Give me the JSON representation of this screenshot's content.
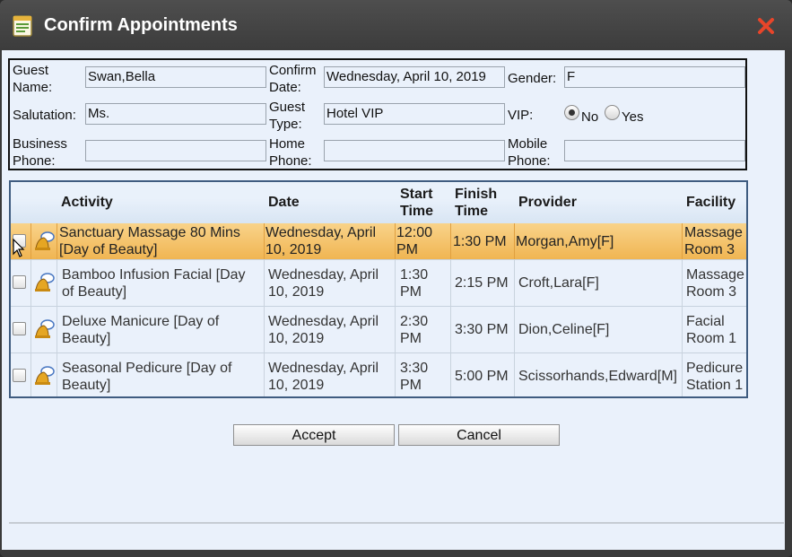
{
  "window": {
    "title": "Confirm Appointments",
    "icon": "document-icon",
    "close_icon": "close-x-icon",
    "accent": "#e8452a"
  },
  "guest": {
    "name_label_1": "Guest",
    "name_label_2": "Name:",
    "name_value": "Swan,Bella",
    "confirm_label_1": "Confirm",
    "confirm_label_2": "Date:",
    "confirm_value": "Wednesday, April 10, 2019",
    "gender_label": "Gender:",
    "gender_value": "F",
    "salutation_label": "Salutation:",
    "salutation_value": "Ms.",
    "type_label_1": "Guest",
    "type_label_2": "Type:",
    "type_value": "Hotel VIP",
    "vip_label": "VIP:",
    "vip_no": "No",
    "vip_yes": "Yes",
    "vip_selected": "No",
    "business_label_1": "Business",
    "business_label_2": "Phone:",
    "business_value": "",
    "home_label_1": "Home",
    "home_label_2": "Phone:",
    "home_value": "",
    "mobile_label_1": "Mobile",
    "mobile_label_2": "Phone:",
    "mobile_value": ""
  },
  "table": {
    "headers": {
      "activity": "Activity",
      "date": "Date",
      "start_1": "Start",
      "start_2": "Time",
      "finish_1": "Finish",
      "finish_2": "Time",
      "provider": "Provider",
      "facility": "Facility"
    },
    "rows": [
      {
        "activity_1": "Sanctuary Massage 80 Mins",
        "activity_2": "[Day of Beauty]",
        "date_1": "Wednesday, April",
        "date_2": "10, 2019",
        "start_1": "12:00",
        "start_2": "PM",
        "finish": "1:30 PM",
        "provider": "Morgan,Amy[F]",
        "facility_1": "Massage",
        "facility_2": "Room 3",
        "selected": true
      },
      {
        "activity_1": "Bamboo Infusion Facial [Day",
        "activity_2": "of Beauty]",
        "date_1": "Wednesday, April",
        "date_2": "10, 2019",
        "start_1": "1:30",
        "start_2": "PM",
        "finish": "2:15 PM",
        "provider": "Croft,Lara[F]",
        "facility_1": "Massage",
        "facility_2": "Room 3",
        "selected": false
      },
      {
        "activity_1": "Deluxe Manicure [Day of",
        "activity_2": "Beauty]",
        "date_1": "Wednesday, April",
        "date_2": "10, 2019",
        "start_1": "2:30",
        "start_2": "PM",
        "finish": "3:30 PM",
        "provider": "Dion,Celine[F]",
        "facility_1": "Facial",
        "facility_2": "Room 1",
        "selected": false
      },
      {
        "activity_1": "Seasonal Pedicure [Day of",
        "activity_2": "Beauty]",
        "date_1": "Wednesday, April",
        "date_2": "10, 2019",
        "start_1": "3:30",
        "start_2": "PM",
        "finish": "5:00 PM",
        "provider": "Scissorhands,Edward[M]",
        "facility_1": "Pedicure",
        "facility_2": "Station 1",
        "selected": false
      }
    ],
    "row_icon": "bell-icon"
  },
  "buttons": {
    "accept": "Accept",
    "cancel": "Cancel"
  }
}
